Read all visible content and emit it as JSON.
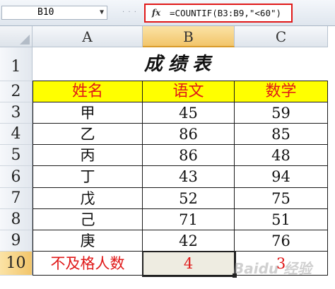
{
  "formula_bar": {
    "name_box": "B10",
    "dots": "·  ·  ·",
    "fx_label": "fx",
    "formula": "=COUNTIF(B3:B9,\"<60\")"
  },
  "columns": [
    "A",
    "B",
    "C"
  ],
  "rows": [
    "1",
    "2",
    "3",
    "4",
    "5",
    "6",
    "7",
    "8",
    "9",
    "10"
  ],
  "sheet": {
    "title": "成绩表",
    "headers": [
      "姓名",
      "语文",
      "数学"
    ],
    "records": [
      {
        "name": "甲",
        "chinese": "45",
        "math": "59"
      },
      {
        "name": "乙",
        "chinese": "86",
        "math": "85"
      },
      {
        "name": "丙",
        "chinese": "86",
        "math": "48"
      },
      {
        "name": "丁",
        "chinese": "43",
        "math": "94"
      },
      {
        "name": "戊",
        "chinese": "52",
        "math": "75"
      },
      {
        "name": "己",
        "chinese": "71",
        "math": "51"
      },
      {
        "name": "庚",
        "chinese": "42",
        "math": "76"
      }
    ],
    "summary": {
      "label": "不及格人数",
      "chinese": "4",
      "math": "3"
    }
  },
  "selected_cell": "B10",
  "watermark": "Baidu 经验",
  "colors": {
    "header_fill": "#ffff00",
    "header_text": "#e01818",
    "highlight_border": "#e01818",
    "selection_fill": "#eeece1"
  }
}
